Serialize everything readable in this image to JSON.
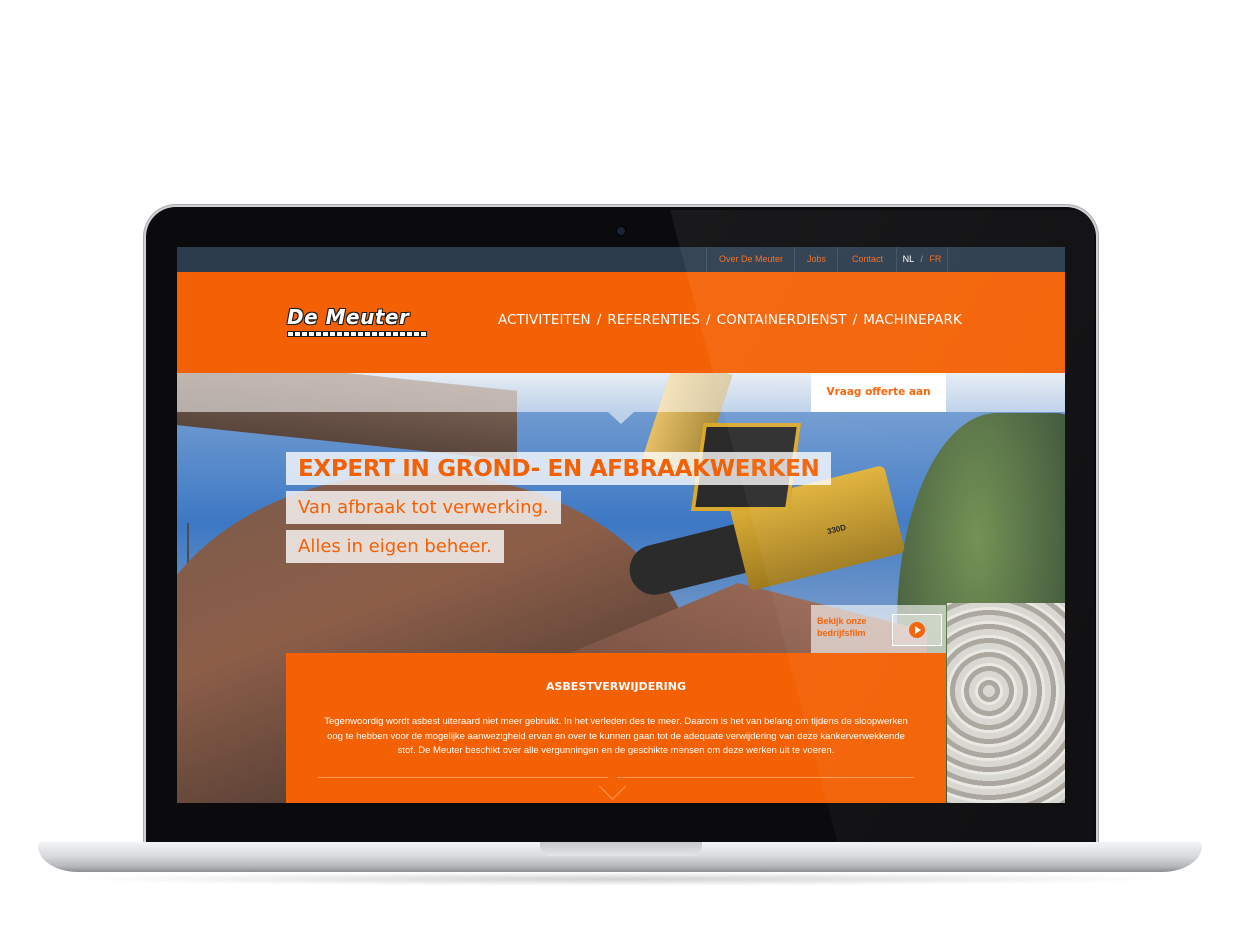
{
  "topbar": {
    "links": [
      "Over De Meuter",
      "Jobs",
      "Contact"
    ],
    "lang_active": "NL",
    "lang_separator": "/",
    "lang_other": "FR"
  },
  "brand": {
    "logo_text": "De Meuter"
  },
  "nav": {
    "items": [
      "ACTIVITEITEN",
      "REFERENTIES",
      "CONTAINERDIENST",
      "MACHINEPARK"
    ],
    "separator": "/"
  },
  "hero": {
    "quote_button": "Vraag offerte aan",
    "headline": "EXPERT IN GROND- EN AFBRAAKWERKEN",
    "subline1": "Van afbraak tot verwerking.",
    "subline2": "Alles in eigen beheer.",
    "film_label": "Bekijk onze bedrijfsfilm",
    "excavator_model": "330D"
  },
  "info": {
    "title": "ASBESTVERWIJDERING",
    "body": "Tegenwoordig wordt asbest uiteraard niet meer gebruikt. In het verleden des te meer. Daarom is het van belang om tijdens de sloopwerken oog te hebben voor de mogelijke aanwezigheid ervan en over te kunnen gaan tot de adequate verwijdering van deze kankerverwekkende stof. De Meuter beschikt over alle vergunningen en de geschikte mensen om deze werken uit te voeren."
  },
  "colors": {
    "accent": "#f46104",
    "topbar": "#2b3b4c",
    "white": "#ffffff"
  },
  "icons": [
    "play-icon",
    "chevron-down-icon",
    "camera-icon"
  ]
}
